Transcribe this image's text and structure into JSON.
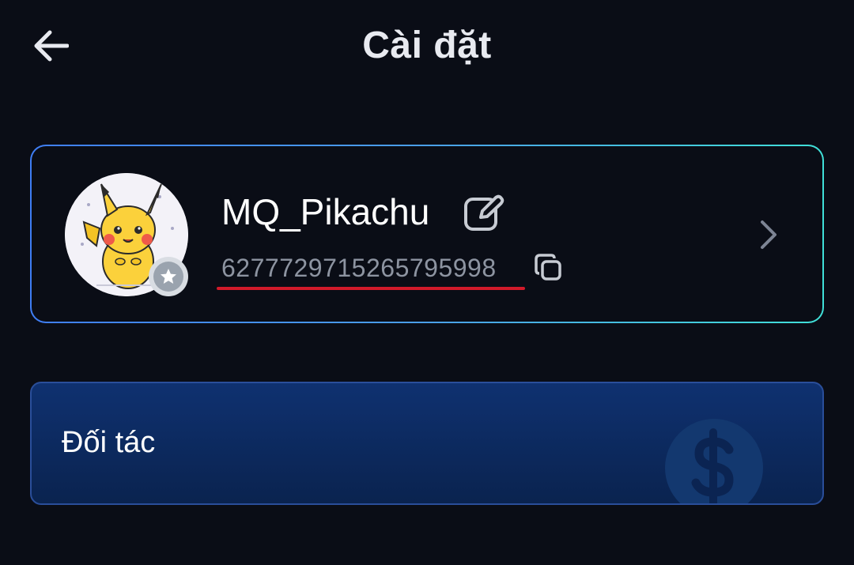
{
  "header": {
    "title": "Cài đặt",
    "back_icon": "arrow-left-icon"
  },
  "profile": {
    "username": "MQ_Pikachu",
    "user_id": "627772971526579599 8",
    "edit_icon": "edit-icon",
    "copy_icon": "copy-icon",
    "chevron_icon": "chevron-right-icon",
    "badge_icon": "star-badge-icon",
    "id_highlight_color": "#d21a2a",
    "border_gradient": [
      "#3f7ef5",
      "#40e0d8"
    ]
  },
  "partner": {
    "label": "Đối tác",
    "icon": "dollar-icon",
    "background": "#0f3170"
  }
}
